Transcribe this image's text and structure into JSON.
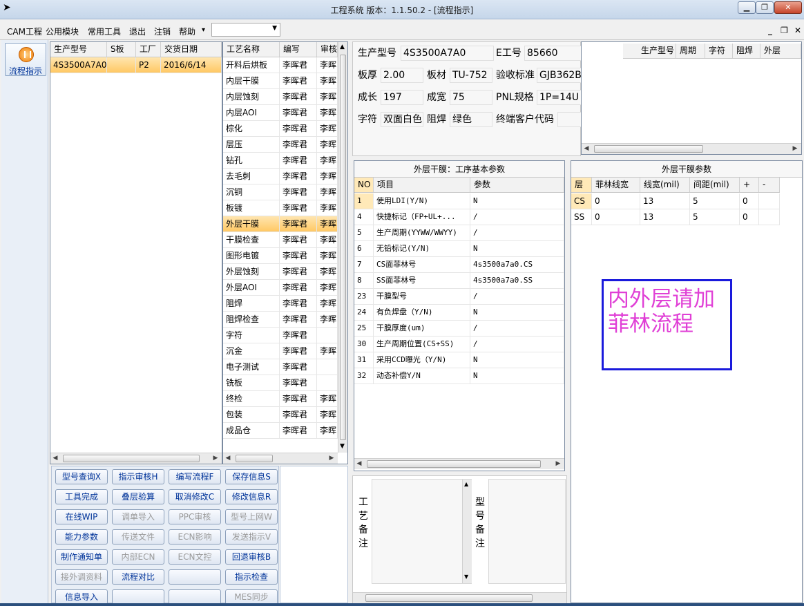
{
  "window": {
    "title": "工程系统  版本：1.1.50.2 - [流程指示]",
    "min": "▁",
    "max": "❐",
    "close": "✕"
  },
  "menu": {
    "items": [
      "CAM工程",
      "公用模块",
      "常用工具",
      "退出",
      "注销",
      "帮助"
    ],
    "help_arrow": "▾",
    "combo_value": "",
    "mdi_min": "_",
    "mdi_restore": "❐",
    "mdi_close": "✕"
  },
  "nav": {
    "button_label": "流程指示",
    "icon": "pause-circle-icon"
  },
  "orders": {
    "headers": [
      "生产型号",
      "S板",
      "工厂",
      "交货日期"
    ],
    "rows": [
      {
        "model": "4S3500A7A0",
        "sboard": "",
        "factory": "P2",
        "date": "2016/6/14"
      }
    ]
  },
  "processes": {
    "headers": [
      "工艺名称",
      "编写",
      "审核"
    ],
    "rows": [
      [
        "开料后烘板",
        "李晖君",
        "李晖"
      ],
      [
        "内层干膜",
        "李晖君",
        "李晖"
      ],
      [
        "内层蚀刻",
        "李晖君",
        "李晖"
      ],
      [
        "内层AOI",
        "李晖君",
        "李晖"
      ],
      [
        "棕化",
        "李晖君",
        "李晖"
      ],
      [
        "层压",
        "李晖君",
        "李晖"
      ],
      [
        "钻孔",
        "李晖君",
        "李晖"
      ],
      [
        "去毛刺",
        "李晖君",
        "李晖"
      ],
      [
        "沉铜",
        "李晖君",
        "李晖"
      ],
      [
        "板镀",
        "李晖君",
        "李晖"
      ],
      [
        "外层干膜",
        "李晖君",
        "李晖"
      ],
      [
        "干膜检查",
        "李晖君",
        "李晖"
      ],
      [
        "图形电镀",
        "李晖君",
        "李晖"
      ],
      [
        "外层蚀刻",
        "李晖君",
        "李晖"
      ],
      [
        "外层AOI",
        "李晖君",
        "李晖"
      ],
      [
        "阻焊",
        "李晖君",
        "李晖"
      ],
      [
        "阻焊检查",
        "李晖君",
        "李晖"
      ],
      [
        "字符",
        "李晖君",
        ""
      ],
      [
        "沉金",
        "李晖君",
        "李晖"
      ],
      [
        "电子测试",
        "李晖君",
        ""
      ],
      [
        "铣板",
        "李晖君",
        ""
      ],
      [
        "终检",
        "李晖君",
        "李晖"
      ],
      [
        "包装",
        "李晖君",
        "李晖"
      ],
      [
        "成品仓",
        "李晖君",
        "李晖"
      ]
    ],
    "selected_index": 10
  },
  "buttons": [
    [
      {
        "label": "型号查询X",
        "enabled": true
      },
      {
        "label": "指示审核H",
        "enabled": true
      },
      {
        "label": "编写流程F",
        "enabled": true
      },
      {
        "label": "保存信息S",
        "enabled": true
      }
    ],
    [
      {
        "label": "工具完成",
        "enabled": true
      },
      {
        "label": "叠层验算",
        "enabled": true
      },
      {
        "label": "取消修改C",
        "enabled": true
      },
      {
        "label": "修改信息R",
        "enabled": true
      }
    ],
    [
      {
        "label": "在线WIP",
        "enabled": true
      },
      {
        "label": "调单导入",
        "enabled": false
      },
      {
        "label": "PPC审核",
        "enabled": false
      },
      {
        "label": "型号上网W",
        "enabled": false
      }
    ],
    [
      {
        "label": "能力参数",
        "enabled": true
      },
      {
        "label": "传送文件",
        "enabled": false
      },
      {
        "label": "ECN影响",
        "enabled": false
      },
      {
        "label": "发送指示V",
        "enabled": false
      }
    ],
    [
      {
        "label": "制作通知单",
        "enabled": true
      },
      {
        "label": "内部ECN",
        "enabled": false
      },
      {
        "label": "ECN文控",
        "enabled": false
      },
      {
        "label": "回退审核B",
        "enabled": true
      }
    ],
    [
      {
        "label": "接外调资料",
        "enabled": false
      },
      {
        "label": "流程对比",
        "enabled": true
      },
      {
        "label": "",
        "enabled": true
      },
      {
        "label": "指示检查",
        "enabled": true
      }
    ],
    [
      {
        "label": "信息导入",
        "enabled": true
      },
      {
        "label": "",
        "enabled": true
      },
      {
        "label": "",
        "enabled": true
      },
      {
        "label": "MES同步",
        "enabled": false
      }
    ]
  ],
  "info": {
    "model_label": "生产型号",
    "model_value": "4S3500A7A0",
    "eng_label": "E工号",
    "eng_value": "85660",
    "thick_label": "板厚",
    "thick_value": "2.00",
    "mat_label": "板材",
    "mat_value": "TU-752",
    "std_label": "验收标准",
    "std_value": "GJB362B",
    "len_label": "成长",
    "len_value": "197",
    "wid_label": "成宽",
    "wid_value": "75",
    "pnl_label": "PNL规格",
    "pnl_value": "1P=14U",
    "char_label": "字符",
    "char_value": "双面白色",
    "mask_label": "阻焊",
    "mask_value": "绿色",
    "cust_label": "终端客户代码",
    "cust_value": ""
  },
  "related_grid": {
    "headers": [
      "生产型号",
      "周期",
      "字符",
      "阻焊",
      "外层"
    ]
  },
  "basic_params": {
    "title": "外层干膜：工序基本参数",
    "headers": [
      "NO",
      "项目",
      "参数"
    ],
    "rows": [
      [
        "1",
        "使用LDI(Y/N)",
        "N"
      ],
      [
        "4",
        "快捷标记（FP+UL+...",
        "/"
      ],
      [
        "5",
        "生产周期(YYWW/WWYY)",
        "/"
      ],
      [
        "6",
        "无铅标记(Y/N)",
        "N"
      ],
      [
        "7",
        "CS面菲林号",
        "4s3500a7a0.CS"
      ],
      [
        "8",
        "SS面菲林号",
        "4s3500a7a0.SS"
      ],
      [
        "23",
        "干膜型号",
        "/"
      ],
      [
        "24",
        "有负焊盘（Y/N)",
        "N"
      ],
      [
        "25",
        "干膜厚度(um)",
        "/"
      ],
      [
        "30",
        "生产周期位置(CS+SS)",
        "/"
      ],
      [
        "31",
        "采用CCD曝光（Y/N)",
        "N"
      ],
      [
        "32",
        "动态补偿Y/N",
        "N"
      ]
    ]
  },
  "dry_film_params": {
    "title": "外层干膜参数",
    "headers": [
      "层",
      "菲林线宽",
      "线宽(mil)",
      "间距(mil)",
      "+",
      "-"
    ],
    "rows": [
      [
        "CS",
        "0",
        "13",
        "5",
        "0",
        ""
      ],
      [
        "SS",
        "0",
        "13",
        "5",
        "0",
        ""
      ]
    ]
  },
  "notice_text": "内外层请加菲林流程",
  "remarks": {
    "process_label": "工艺备注",
    "model_label": "型号备注",
    "process_value": "",
    "model_value": ""
  },
  "colors": {
    "selection": "#ffc864",
    "notice_text": "#e040d6",
    "notice_border": "#1a1adc"
  }
}
